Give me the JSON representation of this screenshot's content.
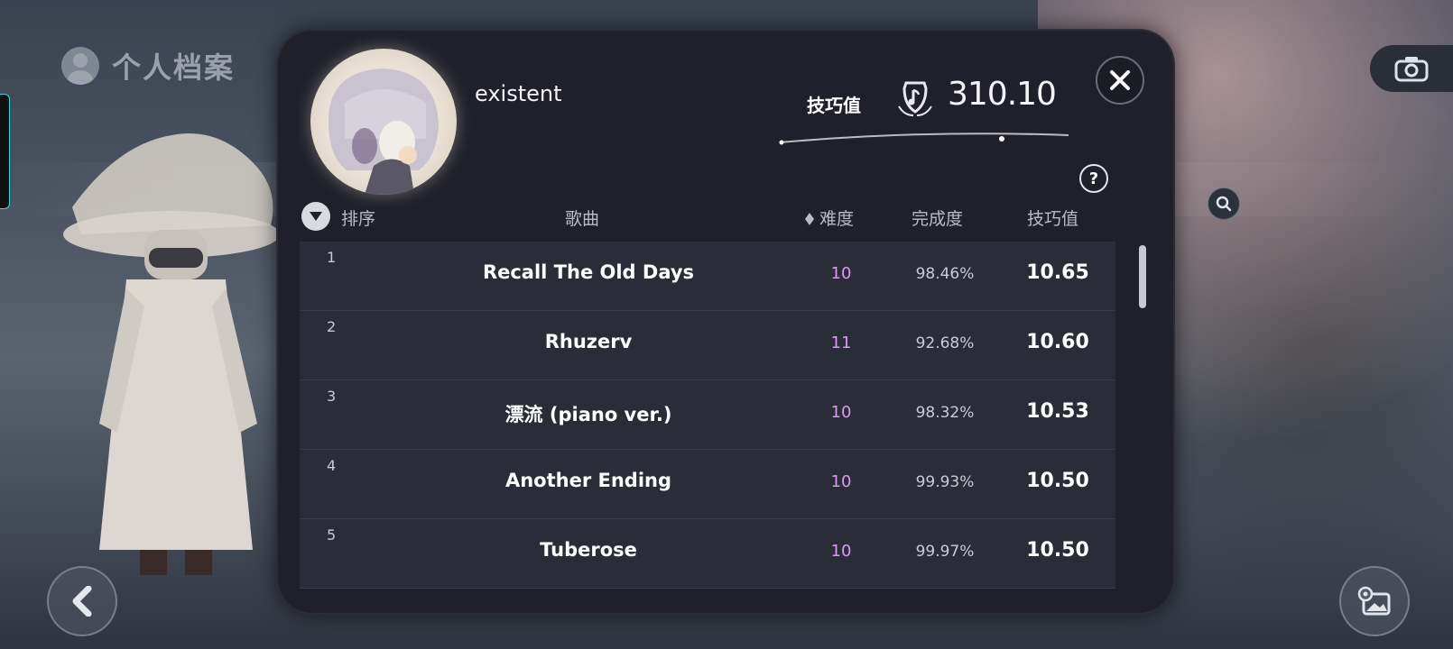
{
  "header": {
    "title": "个人档案"
  },
  "profile": {
    "username": "existent",
    "skill_label": "技巧值",
    "skill_total": "310.10"
  },
  "table": {
    "headers": {
      "rank": "排序",
      "song": "歌曲",
      "difficulty": "难度",
      "accuracy": "完成度",
      "skill": "技巧值"
    },
    "rows": [
      {
        "rank": "1",
        "song": "Recall The Old Days",
        "difficulty": "10",
        "accuracy": "98.46%",
        "skill": "10.65"
      },
      {
        "rank": "2",
        "song": "Rhuzerv",
        "difficulty": "11",
        "accuracy": "92.68%",
        "skill": "10.60"
      },
      {
        "rank": "3",
        "song": "漂流 (piano ver.)",
        "difficulty": "10",
        "accuracy": "98.32%",
        "skill": "10.53"
      },
      {
        "rank": "4",
        "song": "Another Ending",
        "difficulty": "10",
        "accuracy": "99.93%",
        "skill": "10.50"
      },
      {
        "rank": "5",
        "song": "Tuberose",
        "difficulty": "10",
        "accuracy": "99.97%",
        "skill": "10.50"
      }
    ]
  },
  "help": "?",
  "icons": [
    "user-icon",
    "camera-icon",
    "close-icon",
    "help-icon",
    "sort-icon",
    "diamond-icon",
    "back-icon",
    "gallery-settings-icon",
    "search-icon",
    "music-crest-icon"
  ],
  "colors": {
    "modal_bg": "#1f2029",
    "row_bg": "#2a2c37",
    "difficulty": "#d79cf0"
  }
}
